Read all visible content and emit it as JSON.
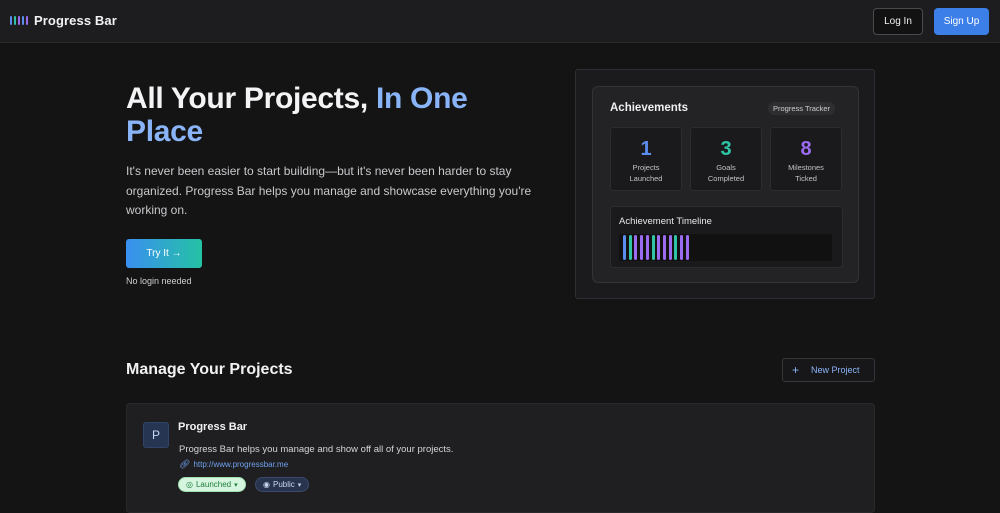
{
  "header": {
    "brand_name": "Progress Bar",
    "login_label": "Log In",
    "signup_label": "Sign Up",
    "accent_color": "#3d7fe8"
  },
  "hero": {
    "title_main": "All Your Projects,",
    "title_accent": "In One Place",
    "subtitle": "It's never been easier to start building—but it's never been harder to stay organized. Progress Bar helps you manage and showcase everything you're working on.",
    "cta_label": "Try It →",
    "cta_note": "No login needed"
  },
  "achievements": {
    "title": "Achievements",
    "tag": "Progress Tracker",
    "stats": [
      {
        "value": "1",
        "label_line1": "Projects",
        "label_line2": "Launched",
        "color": "#5b8def"
      },
      {
        "value": "3",
        "label_line1": "Goals",
        "label_line2": "Completed",
        "color": "#2fc4a6"
      },
      {
        "value": "8",
        "label_line1": "Milestones",
        "label_line2": "Ticked",
        "color": "#9b6bf0"
      }
    ],
    "timeline_title": "Achievement Timeline",
    "timeline_colors": [
      "#5b8def",
      "#2fc4a6",
      "#9b6bf0",
      "#9b6bf0",
      "#9b6bf0",
      "#2fc4a6",
      "#9b6bf0",
      "#9b6bf0",
      "#9b6bf0",
      "#2fc4a6",
      "#9b6bf0",
      "#9b6bf0"
    ]
  },
  "manage": {
    "title": "Manage Your Projects",
    "new_project_label": "New Project"
  },
  "project": {
    "avatar_letter": "P",
    "name": "Progress Bar",
    "description": "Progress Bar helps you manage and show off all of your projects.",
    "url": "http://www.progressbar.me",
    "status": "Launched",
    "visibility": "Public"
  }
}
